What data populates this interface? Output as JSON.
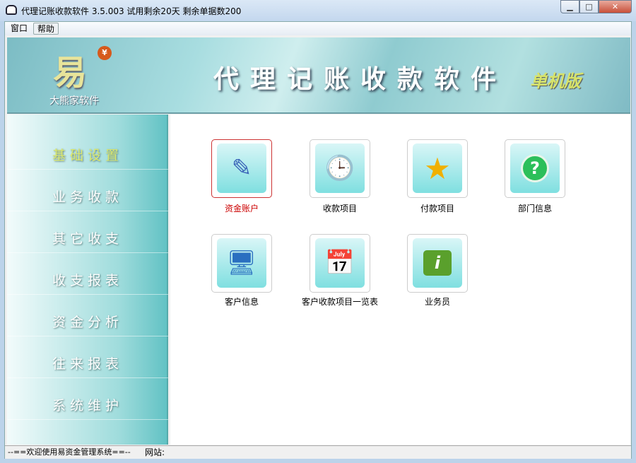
{
  "window": {
    "title": "代理记账收款软件 3.5.003  试用剩余20天  剩余单据数200",
    "min": "▁",
    "max": "□",
    "close": "✕"
  },
  "menu": {
    "items": [
      "窗口",
      "帮助"
    ]
  },
  "banner": {
    "logo": "易",
    "yen": "¥",
    "brand": "大熊家软件",
    "title": "代理记账收款软件",
    "edition": "单机版"
  },
  "sidebar": {
    "items": [
      "基础设置",
      "业务收款",
      "其它收支",
      "收支报表",
      "资金分析",
      "往来报表",
      "系统维护"
    ]
  },
  "tiles": [
    {
      "label": "资金账户",
      "icon": "✎"
    },
    {
      "label": "收款项目",
      "icon": "🕒"
    },
    {
      "label": "付款项目",
      "icon": "★"
    },
    {
      "label": "部门信息",
      "icon": "?"
    },
    {
      "label": "客户信息",
      "icon": "🖥"
    },
    {
      "label": "客户收款项目一览表",
      "icon": "📅"
    },
    {
      "label": "业务员",
      "icon": "i"
    }
  ],
  "status": {
    "welcome": "--==欢迎使用易资金管理系统==--",
    "website_label": "网站:"
  }
}
